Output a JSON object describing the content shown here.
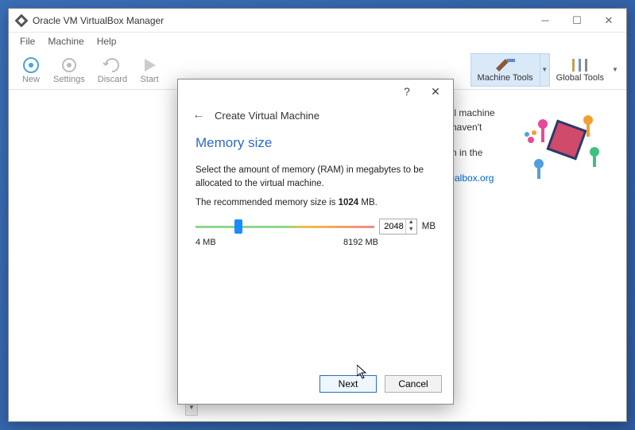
{
  "window": {
    "title": "Oracle VM VirtualBox Manager"
  },
  "menu": {
    "file": "File",
    "machine": "Machine",
    "help": "Help"
  },
  "toolbar": {
    "new": "New",
    "settings": "Settings",
    "discard": "Discard",
    "start": "Start",
    "machine_tools": "Machine Tools",
    "global_tools": "Global Tools"
  },
  "welcome": {
    "line1_suffix": "ual machine",
    "line2_suffix": "u haven't",
    "line3_suffix": "ton in the",
    "link": "rtualbox.org"
  },
  "dialog": {
    "header_title": "Create Virtual Machine",
    "section_title": "Memory size",
    "desc": "Select the amount of memory (RAM) in megabytes to be allocated to the virtual machine.",
    "reco_prefix": "The recommended memory size is ",
    "reco_value": "1024",
    "reco_suffix": " MB.",
    "memory_value": "2048",
    "unit": "MB",
    "min_label": "4 MB",
    "max_label": "8192 MB",
    "next": "Next",
    "cancel": "Cancel"
  }
}
